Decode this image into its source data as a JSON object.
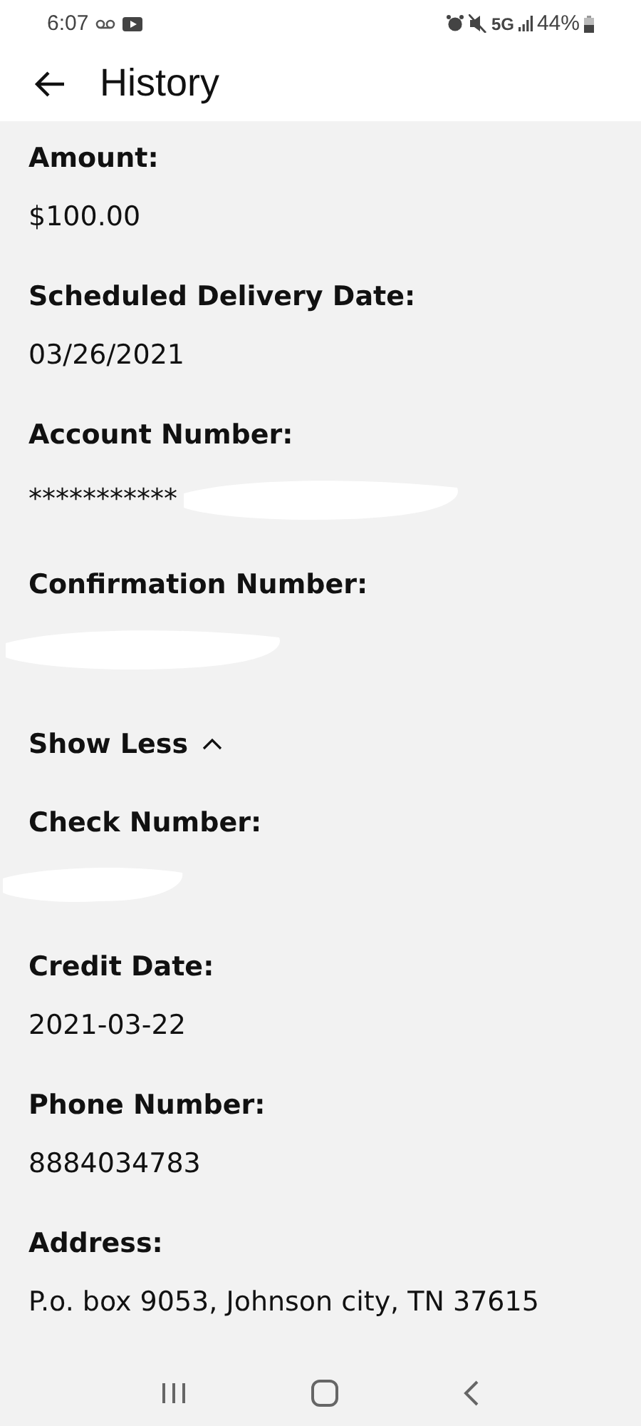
{
  "status_bar": {
    "time": "6:07",
    "signal_label": "5G",
    "battery": "44%"
  },
  "header": {
    "title": "History"
  },
  "fields": [
    {
      "label": "Amount:",
      "value": "$100.00"
    },
    {
      "label": "Scheduled Delivery Date:",
      "value": "03/26/2021"
    },
    {
      "label": "Account Number:",
      "value": "***********",
      "redacted": true
    },
    {
      "label": "Confirmation Number:",
      "redacted": true
    }
  ],
  "toggle": {
    "label": "Show Less",
    "expanded": true
  },
  "more_fields": [
    {
      "label": "Check Number:",
      "redacted": true
    },
    {
      "label": "Credit Date:",
      "value": "2021-03-22"
    },
    {
      "label": "Phone Number:",
      "value": "8884034783"
    },
    {
      "label": "Address:",
      "value": "P.o. box 9053, Johnson city, TN 37615"
    }
  ]
}
